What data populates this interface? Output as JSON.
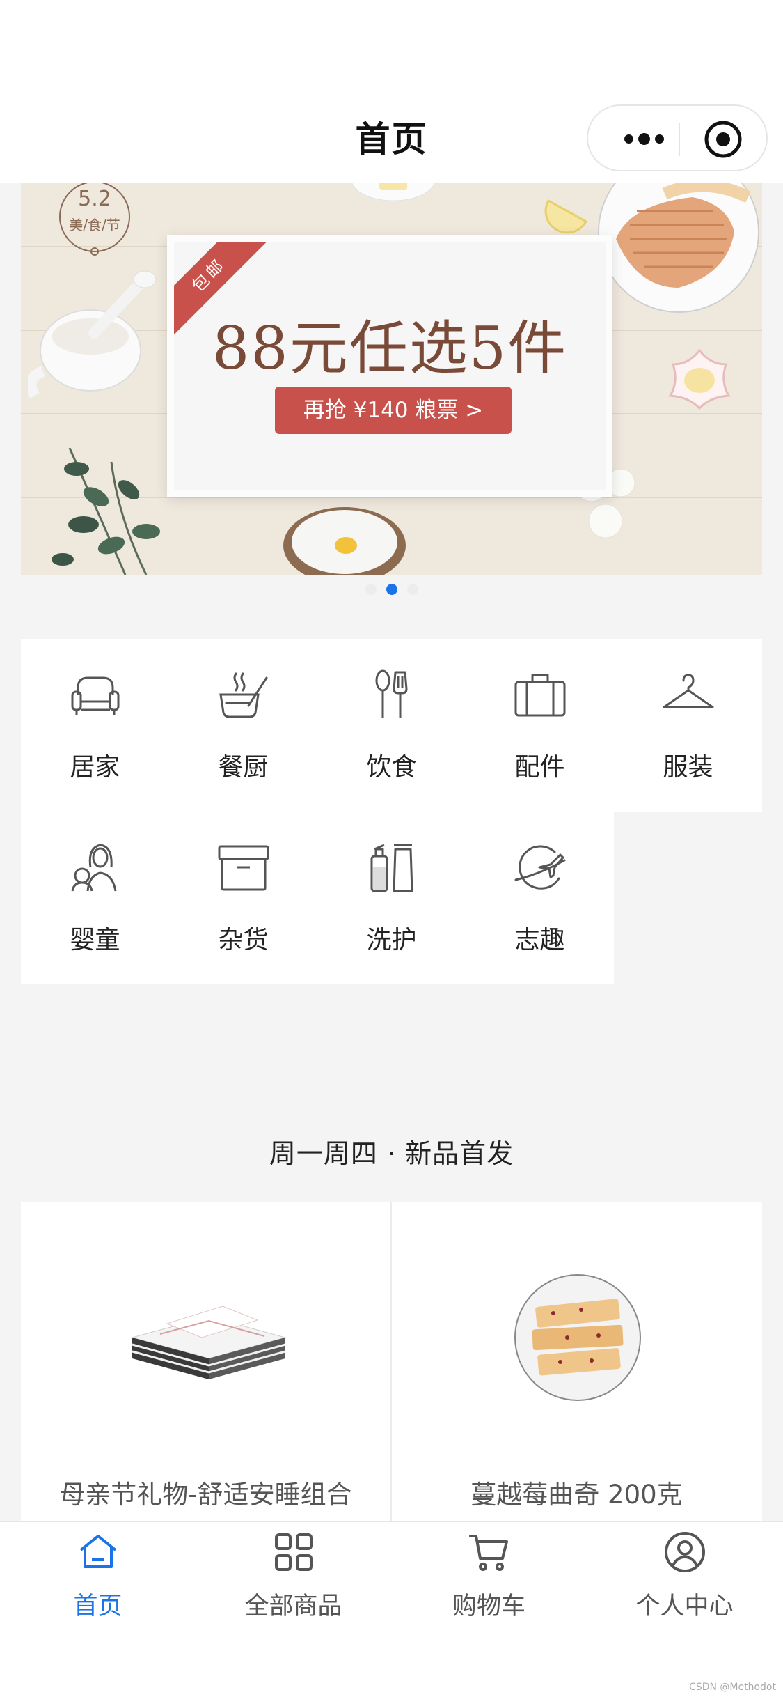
{
  "header": {
    "title": "首页",
    "more_icon": "more-dots-icon",
    "close_icon": "target-circle-icon"
  },
  "banner": {
    "badge": "包邮",
    "stamp_number": "5.2",
    "stamp_text": "美/食/节",
    "headline": "88元任选5件",
    "cta": "再抢 ¥140 粮票 >",
    "slide_count": 3,
    "active_slide": 2
  },
  "categories": [
    {
      "label": "居家",
      "icon": "sofa-icon"
    },
    {
      "label": "餐厨",
      "icon": "cookware-icon"
    },
    {
      "label": "饮食",
      "icon": "utensils-icon"
    },
    {
      "label": "配件",
      "icon": "suitcase-icon"
    },
    {
      "label": "服装",
      "icon": "hanger-icon"
    },
    {
      "label": "婴童",
      "icon": "mother-child-icon"
    },
    {
      "label": "杂货",
      "icon": "storage-box-icon"
    },
    {
      "label": "洗护",
      "icon": "toiletries-icon"
    },
    {
      "label": "志趣",
      "icon": "globe-plane-icon"
    }
  ],
  "section": {
    "title": "周一周四 · 新品首发"
  },
  "products": [
    {
      "name": "母亲节礼物-舒适安睡组合"
    },
    {
      "name": "蔓越莓曲奇 200克"
    }
  ],
  "tabbar": [
    {
      "label": "首页",
      "icon": "home-icon",
      "active": true
    },
    {
      "label": "全部商品",
      "icon": "grid-icon",
      "active": false
    },
    {
      "label": "购物车",
      "icon": "cart-icon",
      "active": false
    },
    {
      "label": "个人中心",
      "icon": "user-icon",
      "active": false
    }
  ],
  "colors": {
    "accent": "#1a73e8",
    "banner_red": "#c9514b",
    "headline_brown": "#7a4a38",
    "background": "#f4f4f4"
  },
  "watermark": "CSDN @Methodot"
}
